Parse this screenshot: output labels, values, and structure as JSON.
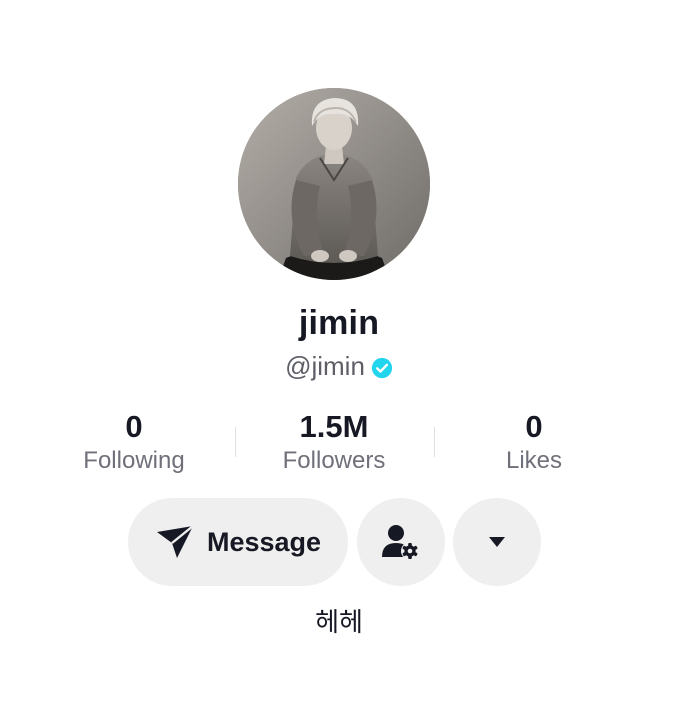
{
  "profile": {
    "display_name": "jimin",
    "handle": "@jimin",
    "verified": true,
    "bio": "헤헤"
  },
  "stats": {
    "following": {
      "value": "0",
      "label": "Following"
    },
    "followers": {
      "value": "1.5M",
      "label": "Followers"
    },
    "likes": {
      "value": "0",
      "label": "Likes"
    }
  },
  "actions": {
    "message_label": "Message",
    "message_icon": "send-icon",
    "follow_settings_icon": "user-gear-icon",
    "more_icon": "caret-down-icon"
  },
  "colors": {
    "verified": "#20d5ec",
    "button_bg": "#efefef",
    "text_primary": "#161823",
    "text_secondary": "#6f7079"
  }
}
